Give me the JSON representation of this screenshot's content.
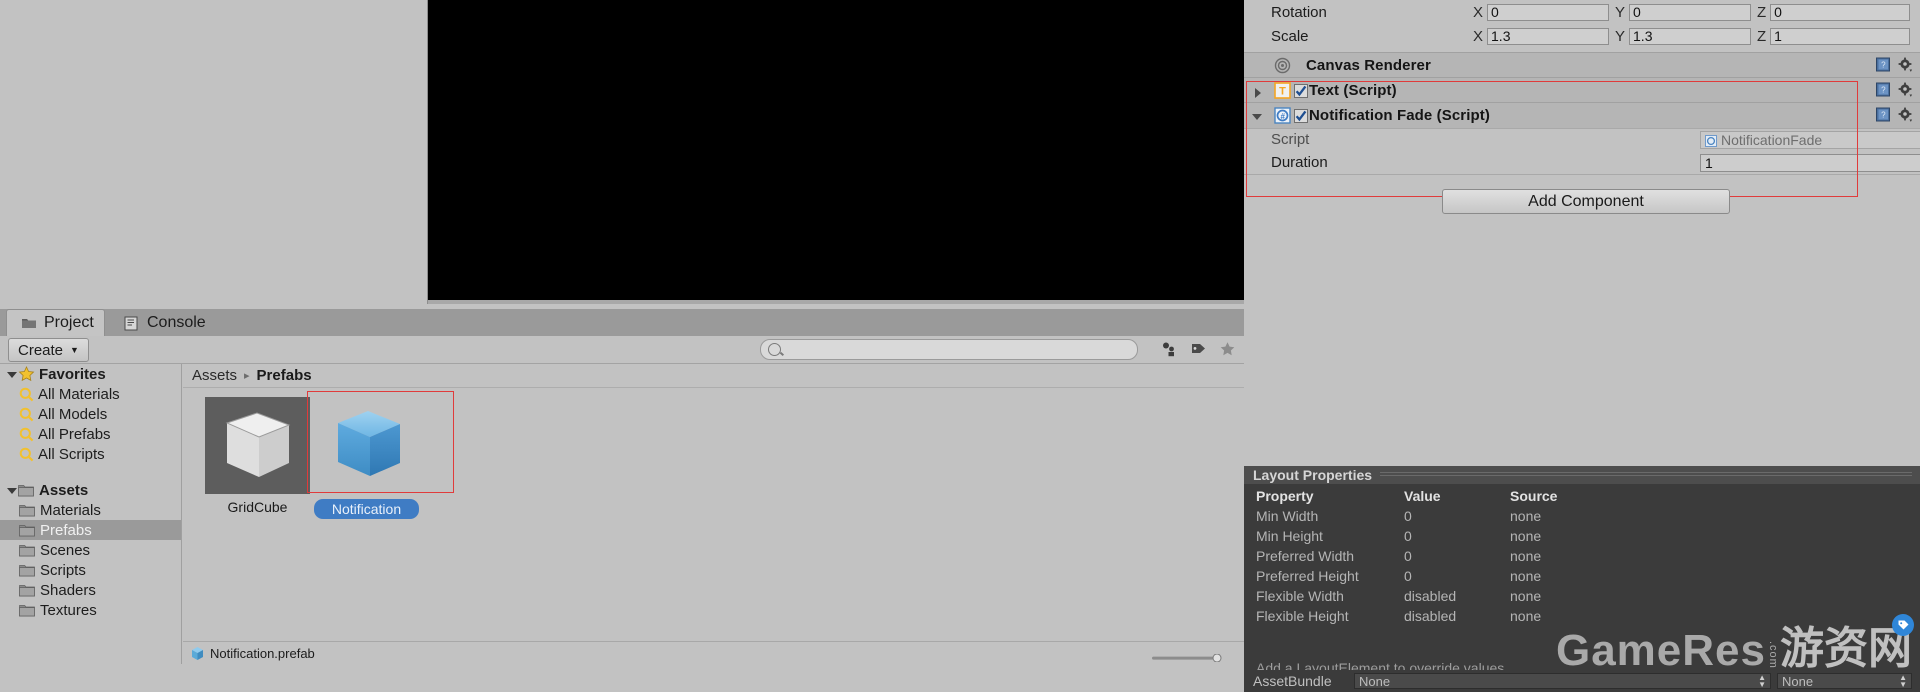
{
  "window": {
    "app": "Unity Editor"
  },
  "inspector": {
    "transform": {
      "rows": [
        {
          "label": "Rotation",
          "x": "0",
          "y": "0",
          "z": "0"
        },
        {
          "label": "Scale",
          "x": "1.3",
          "y": "1.3",
          "z": "1"
        }
      ],
      "axis_x": "X",
      "axis_y": "Y",
      "axis_z": "Z"
    },
    "components": [
      {
        "title": "Canvas Renderer",
        "icon": "canvas-renderer-icon",
        "expanded": false,
        "has_checkbox": false,
        "checked": false
      },
      {
        "title": "Text (Script)",
        "icon": "text-script-icon",
        "expanded": false,
        "has_checkbox": true,
        "checked": true
      },
      {
        "title": "Notification Fade (Script)",
        "icon": "csharp-script-icon",
        "expanded": true,
        "has_checkbox": true,
        "checked": true
      }
    ],
    "notification_fade": {
      "script_label": "Script",
      "script_value": "NotificationFade",
      "duration_label": "Duration",
      "duration_value": "1"
    },
    "add_component_label": "Add Component",
    "help_icon": "help-book-icon",
    "gear_icon": "gear-icon"
  },
  "preview": {
    "title": "Layout Properties",
    "columns": [
      "Property",
      "Value",
      "Source"
    ],
    "rows": [
      {
        "property": "Min Width",
        "value": "0",
        "source": "none"
      },
      {
        "property": "Min Height",
        "value": "0",
        "source": "none"
      },
      {
        "property": "Preferred Width",
        "value": "0",
        "source": "none"
      },
      {
        "property": "Preferred Height",
        "value": "0",
        "source": "none"
      },
      {
        "property": "Flexible Width",
        "value": "disabled",
        "source": "none"
      },
      {
        "property": "Flexible Height",
        "value": "disabled",
        "source": "none"
      }
    ],
    "note": "Add a LayoutElement to override values",
    "assetbundle_label": "AssetBundle",
    "assetbundle_value": "None",
    "assetbundle_variant": "None"
  },
  "project": {
    "tabs": [
      {
        "label": "Project",
        "icon": "folder-icon",
        "active": true
      },
      {
        "label": "Console",
        "icon": "console-icon",
        "active": false
      }
    ],
    "create_label": "Create",
    "search_placeholder": "",
    "search_value": "",
    "toolbar_icons": [
      "asset-filter-icon",
      "label-tag-icon",
      "favorite-star-icon"
    ],
    "tree": [
      {
        "label": "Favorites",
        "type": "root",
        "icon": "star-icon",
        "expanded": true,
        "bold": true,
        "selected": false
      },
      {
        "label": "All Materials",
        "type": "search",
        "icon": "search-icon",
        "selected": false
      },
      {
        "label": "All Models",
        "type": "search",
        "icon": "search-icon",
        "selected": false
      },
      {
        "label": "All Prefabs",
        "type": "search",
        "icon": "search-icon",
        "selected": false
      },
      {
        "label": "All Scripts",
        "type": "search",
        "icon": "search-icon",
        "selected": false
      },
      {
        "label": "",
        "type": "spacer"
      },
      {
        "label": "Assets",
        "type": "root",
        "icon": "folder-icon",
        "expanded": true,
        "bold": true,
        "selected": false
      },
      {
        "label": "Materials",
        "type": "folder",
        "icon": "folder-icon",
        "selected": false
      },
      {
        "label": "Prefabs",
        "type": "folder",
        "icon": "folder-icon",
        "selected": true
      },
      {
        "label": "Scenes",
        "type": "folder",
        "icon": "folder-icon",
        "selected": false
      },
      {
        "label": "Scripts",
        "type": "folder",
        "icon": "folder-icon",
        "selected": false
      },
      {
        "label": "Shaders",
        "type": "folder",
        "icon": "folder-icon",
        "selected": false
      },
      {
        "label": "Textures",
        "type": "folder",
        "icon": "folder-icon",
        "selected": false
      }
    ],
    "breadcrumb": {
      "root": "Assets",
      "current": "Prefabs",
      "separator": "▸"
    },
    "assets": [
      {
        "name": "GridCube",
        "type": "prefab-gray",
        "selected": false
      },
      {
        "name": "Notification",
        "type": "prefab-blue",
        "selected": true
      }
    ],
    "status": {
      "file": "Notification.prefab",
      "icon": "prefab-icon"
    }
  },
  "watermark": {
    "english": "GameRes",
    "com": ".com",
    "chinese": "游资网"
  },
  "colors": {
    "panel": "#c2c2c2",
    "dark_panel": "#383838",
    "selection_red": "#e03b3b",
    "selection_blue": "#3f7cc4",
    "accent_orange": "#f5a623"
  }
}
